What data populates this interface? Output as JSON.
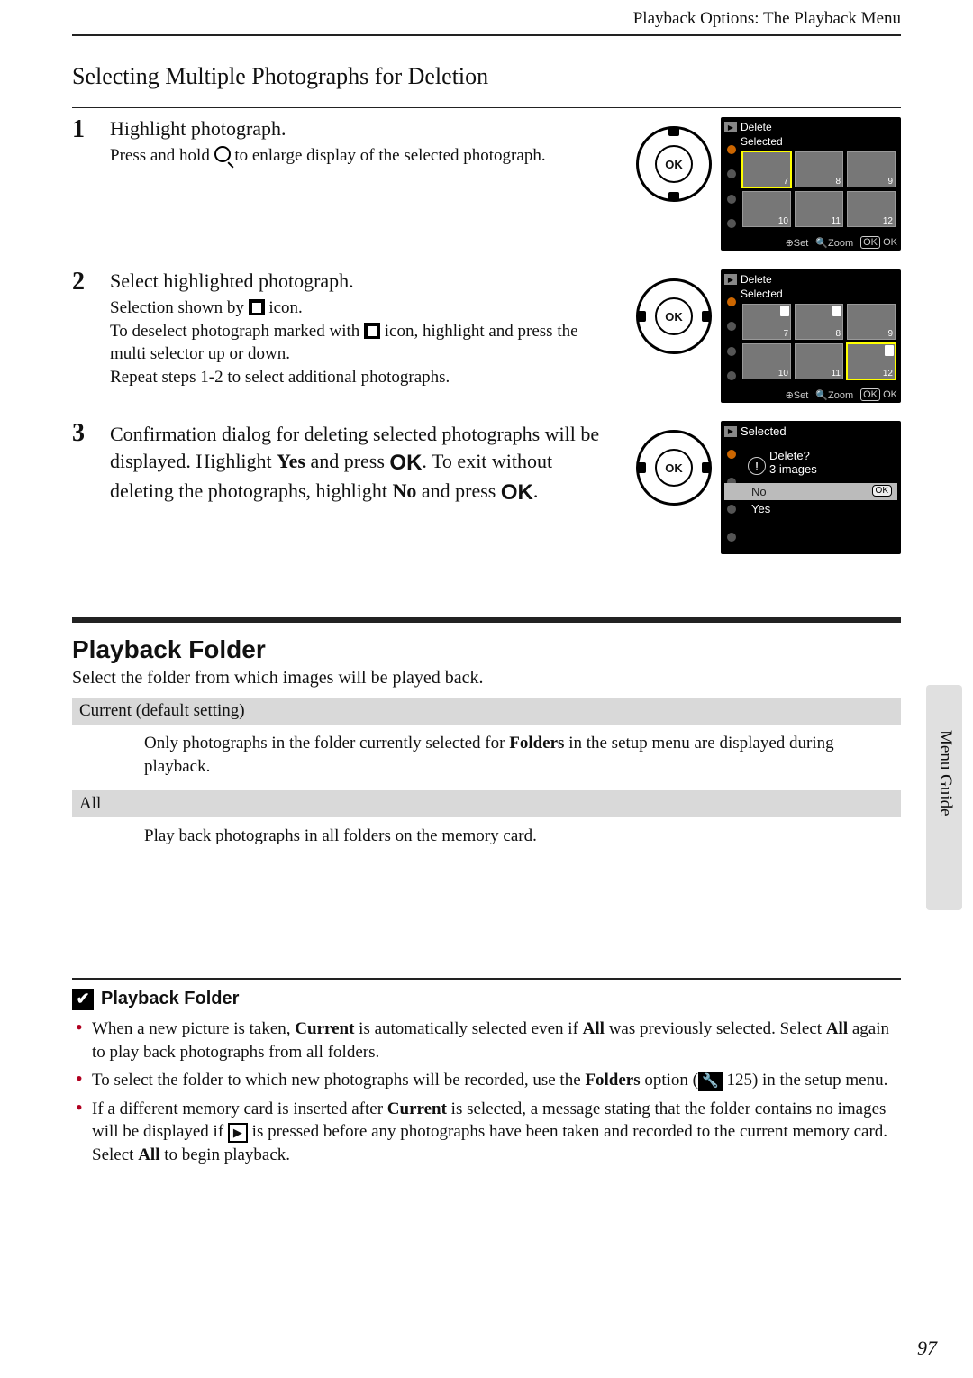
{
  "running_head": "Playback Options: The Playback Menu",
  "side_label": "Menu Guide",
  "page_number": "97",
  "section_title": "Selecting Multiple Photographs for Deletion",
  "steps": {
    "s1": {
      "num": "1",
      "heading": "Highlight photograph.",
      "text_a": "Press and hold ",
      "text_b": " to enlarge display of the selected photograph."
    },
    "s2": {
      "num": "2",
      "heading": "Select highlighted photograph.",
      "line1_a": "Selection shown by ",
      "line1_b": " icon.",
      "line2_a": "To deselect photograph marked with ",
      "line2_b": " icon, highlight and press the multi selector up or down.",
      "line3": "Repeat steps 1-2 to select additional photographs."
    },
    "s3": {
      "num": "3",
      "text_a": "Confirmation dialog for deleting selected photographs will be displayed. Highlight ",
      "yes": "Yes",
      "text_b": " and press ",
      "ok1": "OK",
      "text_c": ". To exit without deleting the photographs, highlight ",
      "no": "No",
      "text_d": " and press ",
      "ok2": "OK",
      "text_e": "."
    }
  },
  "lcd": {
    "delete": "Delete",
    "selected": "Selected",
    "set": "Set",
    "zoom": "Zoom",
    "ok": "OK",
    "thumbs_row1": [
      "7",
      "8",
      "9"
    ],
    "thumbs_row2": [
      "10",
      "11",
      "12"
    ],
    "confirm_q": "Delete?",
    "confirm_n": "3  images",
    "no": "No",
    "yes": "Yes"
  },
  "playback_folder": {
    "heading": "Playback Folder",
    "lead": "Select the folder from which images will be played back.",
    "opt1_head": "Current (default setting)",
    "opt1_body_a": "Only photographs in the folder currently selected for ",
    "opt1_body_bold": "Folders",
    "opt1_body_b": " in the setup menu are displayed during playback.",
    "opt2_head": "All",
    "opt2_body": "Play back photographs in all folders on the memory card."
  },
  "note": {
    "title": "Playback Folder",
    "b1_a": "When a new picture is taken, ",
    "b1_current": "Current",
    "b1_b": " is automatically selected even if ",
    "b1_all": "All",
    "b1_c": " was previously selected. Select ",
    "b1_all2": "All",
    "b1_d": " again to play back photographs from all folders.",
    "b2_a": "To select the folder to which new photographs will be recorded, use the ",
    "b2_folders": "Folders",
    "b2_b": " option (",
    "b2_page": " 125) in the setup menu.",
    "b3_a": "If a different memory card is inserted after ",
    "b3_current": "Current",
    "b3_b": " is selected, a message stating that the folder contains no images will be displayed if ",
    "b3_c": " is pressed before any photographs have been taken and recorded to the current memory card. Select ",
    "b3_all": "All",
    "b3_d": " to begin playback."
  }
}
